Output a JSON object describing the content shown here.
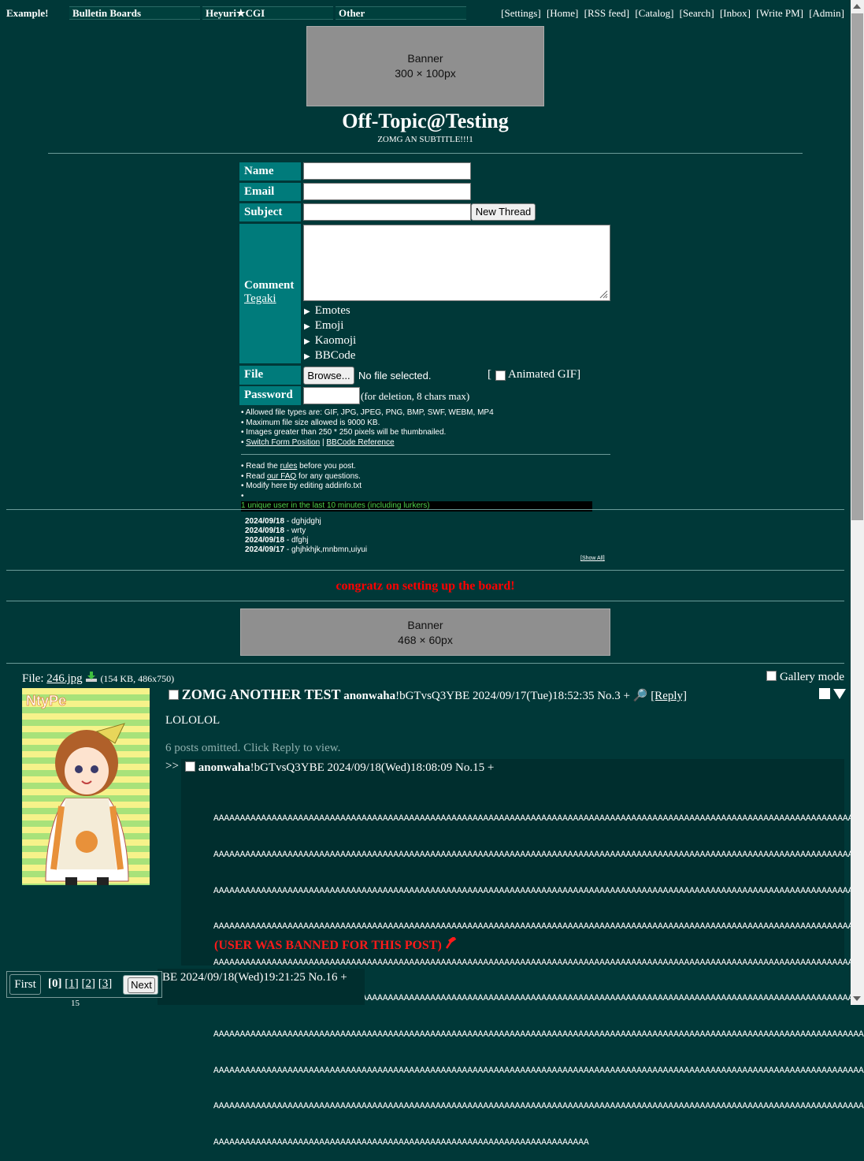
{
  "topbar": {
    "site_title": "Example!",
    "menus": [
      "Bulletin Boards",
      "Heyuri★CGI",
      "Other"
    ],
    "links": [
      "[Settings]",
      "[Home]",
      "[RSS feed]",
      "[Catalog]",
      "[Search]",
      "[Inbox]",
      "[Write PM]",
      "[Admin]"
    ]
  },
  "banner_top": {
    "line1": "Banner",
    "line2": "300 × 100px"
  },
  "board": {
    "title": "Off-Topic@Testing",
    "subtitle": "ZOMG AN SUBTITLE!!!1"
  },
  "form": {
    "name_label": "Name",
    "email_label": "Email",
    "subject_label": "Subject",
    "new_thread_button": "New Thread",
    "comment_label": "Comment",
    "tegaki_link": "Tegaki",
    "details": [
      "Emotes",
      "Emoji",
      "Kaomoji",
      "BBCode"
    ],
    "file_label": "File",
    "browse_button": "Browse...",
    "no_file": "No file selected.",
    "animated_gif": "Animated GIF]",
    "animated_gif_open": "[",
    "password_label": "Password",
    "password_hint": "(for deletion, 8 chars max)"
  },
  "notes": {
    "rules1": "Allowed file types are: GIF, JPG, JPEG, PNG, BMP, SWF, WEBM, MP4",
    "rules2": "Maximum file size allowed is 9000 KB.",
    "rules3": "Images greater than 250 * 250 pixels will be thumbnailed.",
    "switch_link": "Switch Form Position",
    "sep": " | ",
    "bbcode_link": "BBCode Reference",
    "read1_pre": "Read the ",
    "read1_link": "rules",
    "read1_post": " before you post.",
    "read2_pre": "Read ",
    "read2_link": "our FAQ",
    "read2_post": " for any questions.",
    "addinfo": "Modify here by editing addinfo.txt",
    "users_online": "1 unique user in the last 10 minutes (including lurkers)"
  },
  "news": {
    "items": [
      {
        "date": "2024/09/18",
        "text": " - dghjdghj"
      },
      {
        "date": "2024/09/18",
        "text": " - wrty"
      },
      {
        "date": "2024/09/18",
        "text": " - dfghj"
      },
      {
        "date": "2024/09/17",
        "text": " - ghjhkhjk,mnbmn,uiyui"
      }
    ],
    "show_all": "[Show All]"
  },
  "announcement": "congratz on setting up the board!",
  "banner_mid": {
    "line1": "Banner",
    "line2": "468 × 60px"
  },
  "thread": {
    "file_prefix": "File: ",
    "file_name": "246.jpg",
    "file_info": " (154 KB, 486x750)",
    "gallery_mode": "Gallery mode",
    "subject": "ZOMG ANOTHER TEST",
    "poster": "anonwaha",
    "trip": "!bGTvsQ3YBE",
    "datetime": " 2024/09/17(Tue)18:52:35 No.3 +",
    "reply_link": "[Reply]",
    "body": "LOLOLOL",
    "omitted": "6 posts omitted. Click Reply to view.",
    "thumb_text": "NtyPe"
  },
  "reply1": {
    "arrow": ">>",
    "poster": "anonwaha",
    "trip": "!bGTvsQ3YBE",
    "datetime": " 2024/09/18(Wed)18:08:09 No.15 +",
    "body_lines": [
      "AAAAAAAAAAAAAAAAAAAAAAAAAAAAAAAAAAAAAAAAAAAAAAAAAAAAAAAAAAAAAAAAAAAAAAAAAAAAAAAAAAAAAAAAAAAAAAAAAAAAAAAAAAAAAAAAAAAAAAAAAAAAA",
      "AAAAAAAAAAAAAAAAAAAAAAAAAAAAAAAAAAAAAAAAAAAAAAAAAAAAAAAAAAAAAAAAAAAAAAAAAAAAAAAAAAAAAAAAAAAAAAAAAAAAAAAAAAAAAAAAAAAAAAAAAAAAA",
      "AAAAAAAAAAAAAAAAAAAAAAAAAAAAAAAAAAAAAAAAAAAAAAAAAAAAAAAAAAAAAAAAAAAAAAAAAAAAAAAAAAAAAAAAAAAAAAAAAAAAAAAAAAAAAAAAAAAAAAAAAAAAA",
      "AAAAAAAAAAAAAAAAAAAAAAAAAAAAAAAAAAAAAAAAAAAAAAAAAAAAAAAAAAAAAAAAAAAAAAAAAAAAAAAAAAAAAAAAAAAAAAAAAAAAAAAAAAAAAAAAAAAAAAAAAAAAA",
      "AAAAAAAAAAAAAAAAAAAAAAAAAAAAAAAAAAAAAAAAAAAAAAAAAAAAAAAAAAAAAAAAAAAAAAAAAAAAAAAAAAAAAAAAAAAAAAAAAAAAAAAAAAAAAAAAAAAAAAAAAAAAA",
      "AAAAAAAAAAAAAAAAAAAAAAAAAAAAAAAAAAAAAAAAAAAAAAAAAAAAAAAAAAAAAAAAAAAAAAAAAAAAAAAAAAAAAAAAAAAAAAAAAAAAAAAAAAAAAAAAAAAAAAAAAAAAA",
      "AAAAAAAAAAAAAAAAAAAAAAAAAAAAAAAAAAAAAAAAAAAAAAAAAAAAAAAAAAAAAAAAAAAAAAAAAAAAAAAAAAAAAAAAAAAAAAAAAAAAAAAAAAAAAAAAAAAAAAAAAAAAA",
      "AAAAAAAAAAAAAAAAAAAAAAAAAAAAAAAAAAAAAAAAAAAAAAAAAAAAAAAAAAAAAAAAAAAAAAAAAAAAAAAAAAAAAAAAAAAAAAAAAAAAAAAAAAAAAAAAAAAAAAAAAAAAA",
      "AAAAAAAAAAAAAAAAAAAAAAAAAAAAAAAAAAAAAAAAAAAAAAAAAAAAAAAAAAAAAAAAAAAAAAAAAAAAAAAAAAAAAAAAAAAAAAAAAAAAAAAAAAAAAAAAAAAAAAAAAAAAA",
      "AAAAAAAAAAAAAAAAAAAAAAAAAAAAAAAAAAAAAAAAAAAAAAAAAAAAAAAAAAAAAAAAAAAAAAA"
    ],
    "ban_notice": "(USER WAS BANNED FOR THIS POST)"
  },
  "reply2": {
    "datetime_partial": "BE 2024/09/18(Wed)19:21:25 No.16 +",
    "cut_text": "15"
  },
  "pager": {
    "first": "First",
    "current": "[0]",
    "p1": "[1]",
    "p2": "[2]",
    "p3": "[3]",
    "next": "Next",
    "open_bracket": "[",
    "close_bracket": "]"
  },
  "colors": {
    "background": "#003838",
    "label_bg": "#007b7b",
    "banned": "#ff0000",
    "announcement": "#ff0000",
    "online_text": "#4cd24c"
  }
}
